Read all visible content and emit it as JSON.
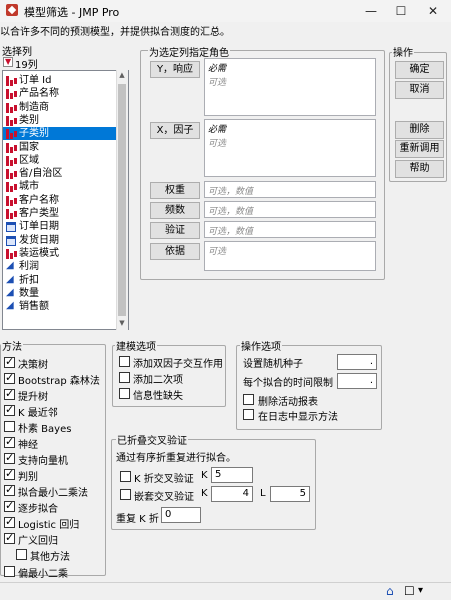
{
  "window": {
    "title": "模型筛选 - JMP Pro",
    "minimize": "—",
    "maximize": "☐",
    "close": "✕"
  },
  "description": "以合许多不同的预测模型，并提供拟合测度的汇总。",
  "select_columns": {
    "label": "选择列",
    "count": "19列",
    "items": [
      {
        "label": "订单 Id",
        "type": "nominal"
      },
      {
        "label": "产品名称",
        "type": "nominal"
      },
      {
        "label": "制造商",
        "type": "nominal"
      },
      {
        "label": "类别",
        "type": "nominal"
      },
      {
        "label": "子类别",
        "type": "nominal",
        "selected": true
      },
      {
        "label": "国家",
        "type": "nominal"
      },
      {
        "label": "区域",
        "type": "nominal"
      },
      {
        "label": "省/自治区",
        "type": "nominal"
      },
      {
        "label": "城市",
        "type": "nominal"
      },
      {
        "label": "客户名称",
        "type": "nominal"
      },
      {
        "label": "客户类型",
        "type": "nominal"
      },
      {
        "label": "订单日期",
        "type": "date"
      },
      {
        "label": "发货日期",
        "type": "date"
      },
      {
        "label": "装运模式",
        "type": "nominal"
      },
      {
        "label": "利润",
        "type": "continuous"
      },
      {
        "label": "折扣",
        "type": "continuous"
      },
      {
        "label": "数量",
        "type": "continuous"
      },
      {
        "label": "销售额",
        "type": "continuous"
      }
    ]
  },
  "roles": {
    "label": "为选定列指定角色",
    "y_button": "Y，响应",
    "x_button": "X，因子",
    "weight_button": "权重",
    "freq_button": "频数",
    "validation_button": "验证",
    "by_button": "依据",
    "required": "必需",
    "optional": "可选",
    "optional_numeric": "可选，数值"
  },
  "actions": {
    "label": "操作",
    "ok": "确定",
    "cancel": "取消",
    "remove": "删除",
    "recall": "重新调用",
    "help": "帮助"
  },
  "methods": {
    "label": "方法",
    "items": [
      {
        "label": "决策树",
        "checked": true
      },
      {
        "label": "Bootstrap 森林法",
        "checked": true
      },
      {
        "label": "提升树",
        "checked": true
      },
      {
        "label": "K 最近邻",
        "checked": true
      },
      {
        "label": "朴素 Bayes",
        "checked": false
      },
      {
        "label": "神经",
        "checked": true
      },
      {
        "label": "支持向量机",
        "checked": true
      },
      {
        "label": "判别",
        "checked": true
      },
      {
        "label": "拟合最小二乘法",
        "checked": true
      },
      {
        "label": "逐步拟合",
        "checked": true
      },
      {
        "label": "Logistic 回归",
        "checked": true
      },
      {
        "label": "广义回归",
        "checked": true
      },
      {
        "label": "其他方法",
        "checked": false
      },
      {
        "label": "偏最小二乘",
        "checked": false
      }
    ]
  },
  "modeling_options": {
    "label": "建模选项",
    "items": [
      {
        "label": "添加双因子交互作用",
        "checked": false
      },
      {
        "label": "添加二次项",
        "checked": false
      },
      {
        "label": "信息性缺失",
        "checked": false
      }
    ]
  },
  "run_options": {
    "label": "操作选项",
    "seed_label": "设置随机种子",
    "seed_value": ".",
    "time_label": "每个拟合的时间限制",
    "time_value": ".",
    "delete_reports": "删除活动报表",
    "show_log": "在日志中显示方法"
  },
  "cv": {
    "label": "已折叠交叉验证",
    "desc": "通过有序折重复进行拟合。",
    "kfold_label": "K 折交叉验证",
    "kfold_k_label": "K",
    "kfold_k": "5",
    "nested_label": "嵌套交叉验证",
    "nested_k_label": "K",
    "nested_k": "4",
    "nested_l_label": "L",
    "nested_l": "5",
    "repeat_label": "重复 K 折",
    "repeat_value": "0"
  },
  "statusbar": {
    "home_icon": "⌂",
    "window_icon": "☐",
    "dropdown_icon": "▾"
  }
}
